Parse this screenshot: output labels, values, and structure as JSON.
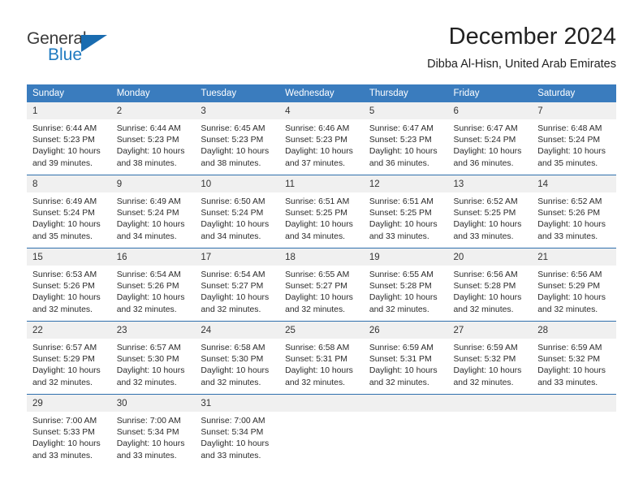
{
  "brand": {
    "name_part1": "General",
    "name_part2": "Blue",
    "flag_icon": "triangle-flag-icon",
    "accent_color": "#1a6cb0"
  },
  "header": {
    "month_title": "December 2024",
    "location": "Dibba Al-Hisn, United Arab Emirates"
  },
  "theme": {
    "header_row_bg": "#3a7cbe",
    "daynum_bg": "#f0f0f0",
    "row_separator": "#2f6fad",
    "text": "#2b2b2b"
  },
  "weekday_headers": [
    "Sunday",
    "Monday",
    "Tuesday",
    "Wednesday",
    "Thursday",
    "Friday",
    "Saturday"
  ],
  "labels": {
    "sunrise_prefix": "Sunrise:",
    "sunset_prefix": "Sunset:",
    "daylight_prefix": "Daylight:"
  },
  "weeks": [
    [
      {
        "day": "1",
        "sunrise": "Sunrise: 6:44 AM",
        "sunset": "Sunset: 5:23 PM",
        "daylight_l1": "Daylight: 10 hours",
        "daylight_l2": "and 39 minutes."
      },
      {
        "day": "2",
        "sunrise": "Sunrise: 6:44 AM",
        "sunset": "Sunset: 5:23 PM",
        "daylight_l1": "Daylight: 10 hours",
        "daylight_l2": "and 38 minutes."
      },
      {
        "day": "3",
        "sunrise": "Sunrise: 6:45 AM",
        "sunset": "Sunset: 5:23 PM",
        "daylight_l1": "Daylight: 10 hours",
        "daylight_l2": "and 38 minutes."
      },
      {
        "day": "4",
        "sunrise": "Sunrise: 6:46 AM",
        "sunset": "Sunset: 5:23 PM",
        "daylight_l1": "Daylight: 10 hours",
        "daylight_l2": "and 37 minutes."
      },
      {
        "day": "5",
        "sunrise": "Sunrise: 6:47 AM",
        "sunset": "Sunset: 5:23 PM",
        "daylight_l1": "Daylight: 10 hours",
        "daylight_l2": "and 36 minutes."
      },
      {
        "day": "6",
        "sunrise": "Sunrise: 6:47 AM",
        "sunset": "Sunset: 5:24 PM",
        "daylight_l1": "Daylight: 10 hours",
        "daylight_l2": "and 36 minutes."
      },
      {
        "day": "7",
        "sunrise": "Sunrise: 6:48 AM",
        "sunset": "Sunset: 5:24 PM",
        "daylight_l1": "Daylight: 10 hours",
        "daylight_l2": "and 35 minutes."
      }
    ],
    [
      {
        "day": "8",
        "sunrise": "Sunrise: 6:49 AM",
        "sunset": "Sunset: 5:24 PM",
        "daylight_l1": "Daylight: 10 hours",
        "daylight_l2": "and 35 minutes."
      },
      {
        "day": "9",
        "sunrise": "Sunrise: 6:49 AM",
        "sunset": "Sunset: 5:24 PM",
        "daylight_l1": "Daylight: 10 hours",
        "daylight_l2": "and 34 minutes."
      },
      {
        "day": "10",
        "sunrise": "Sunrise: 6:50 AM",
        "sunset": "Sunset: 5:24 PM",
        "daylight_l1": "Daylight: 10 hours",
        "daylight_l2": "and 34 minutes."
      },
      {
        "day": "11",
        "sunrise": "Sunrise: 6:51 AM",
        "sunset": "Sunset: 5:25 PM",
        "daylight_l1": "Daylight: 10 hours",
        "daylight_l2": "and 34 minutes."
      },
      {
        "day": "12",
        "sunrise": "Sunrise: 6:51 AM",
        "sunset": "Sunset: 5:25 PM",
        "daylight_l1": "Daylight: 10 hours",
        "daylight_l2": "and 33 minutes."
      },
      {
        "day": "13",
        "sunrise": "Sunrise: 6:52 AM",
        "sunset": "Sunset: 5:25 PM",
        "daylight_l1": "Daylight: 10 hours",
        "daylight_l2": "and 33 minutes."
      },
      {
        "day": "14",
        "sunrise": "Sunrise: 6:52 AM",
        "sunset": "Sunset: 5:26 PM",
        "daylight_l1": "Daylight: 10 hours",
        "daylight_l2": "and 33 minutes."
      }
    ],
    [
      {
        "day": "15",
        "sunrise": "Sunrise: 6:53 AM",
        "sunset": "Sunset: 5:26 PM",
        "daylight_l1": "Daylight: 10 hours",
        "daylight_l2": "and 32 minutes."
      },
      {
        "day": "16",
        "sunrise": "Sunrise: 6:54 AM",
        "sunset": "Sunset: 5:26 PM",
        "daylight_l1": "Daylight: 10 hours",
        "daylight_l2": "and 32 minutes."
      },
      {
        "day": "17",
        "sunrise": "Sunrise: 6:54 AM",
        "sunset": "Sunset: 5:27 PM",
        "daylight_l1": "Daylight: 10 hours",
        "daylight_l2": "and 32 minutes."
      },
      {
        "day": "18",
        "sunrise": "Sunrise: 6:55 AM",
        "sunset": "Sunset: 5:27 PM",
        "daylight_l1": "Daylight: 10 hours",
        "daylight_l2": "and 32 minutes."
      },
      {
        "day": "19",
        "sunrise": "Sunrise: 6:55 AM",
        "sunset": "Sunset: 5:28 PM",
        "daylight_l1": "Daylight: 10 hours",
        "daylight_l2": "and 32 minutes."
      },
      {
        "day": "20",
        "sunrise": "Sunrise: 6:56 AM",
        "sunset": "Sunset: 5:28 PM",
        "daylight_l1": "Daylight: 10 hours",
        "daylight_l2": "and 32 minutes."
      },
      {
        "day": "21",
        "sunrise": "Sunrise: 6:56 AM",
        "sunset": "Sunset: 5:29 PM",
        "daylight_l1": "Daylight: 10 hours",
        "daylight_l2": "and 32 minutes."
      }
    ],
    [
      {
        "day": "22",
        "sunrise": "Sunrise: 6:57 AM",
        "sunset": "Sunset: 5:29 PM",
        "daylight_l1": "Daylight: 10 hours",
        "daylight_l2": "and 32 minutes."
      },
      {
        "day": "23",
        "sunrise": "Sunrise: 6:57 AM",
        "sunset": "Sunset: 5:30 PM",
        "daylight_l1": "Daylight: 10 hours",
        "daylight_l2": "and 32 minutes."
      },
      {
        "day": "24",
        "sunrise": "Sunrise: 6:58 AM",
        "sunset": "Sunset: 5:30 PM",
        "daylight_l1": "Daylight: 10 hours",
        "daylight_l2": "and 32 minutes."
      },
      {
        "day": "25",
        "sunrise": "Sunrise: 6:58 AM",
        "sunset": "Sunset: 5:31 PM",
        "daylight_l1": "Daylight: 10 hours",
        "daylight_l2": "and 32 minutes."
      },
      {
        "day": "26",
        "sunrise": "Sunrise: 6:59 AM",
        "sunset": "Sunset: 5:31 PM",
        "daylight_l1": "Daylight: 10 hours",
        "daylight_l2": "and 32 minutes."
      },
      {
        "day": "27",
        "sunrise": "Sunrise: 6:59 AM",
        "sunset": "Sunset: 5:32 PM",
        "daylight_l1": "Daylight: 10 hours",
        "daylight_l2": "and 32 minutes."
      },
      {
        "day": "28",
        "sunrise": "Sunrise: 6:59 AM",
        "sunset": "Sunset: 5:32 PM",
        "daylight_l1": "Daylight: 10 hours",
        "daylight_l2": "and 33 minutes."
      }
    ],
    [
      {
        "day": "29",
        "sunrise": "Sunrise: 7:00 AM",
        "sunset": "Sunset: 5:33 PM",
        "daylight_l1": "Daylight: 10 hours",
        "daylight_l2": "and 33 minutes."
      },
      {
        "day": "30",
        "sunrise": "Sunrise: 7:00 AM",
        "sunset": "Sunset: 5:34 PM",
        "daylight_l1": "Daylight: 10 hours",
        "daylight_l2": "and 33 minutes."
      },
      {
        "day": "31",
        "sunrise": "Sunrise: 7:00 AM",
        "sunset": "Sunset: 5:34 PM",
        "daylight_l1": "Daylight: 10 hours",
        "daylight_l2": "and 33 minutes."
      },
      {
        "day": "",
        "sunrise": "",
        "sunset": "",
        "daylight_l1": "",
        "daylight_l2": ""
      },
      {
        "day": "",
        "sunrise": "",
        "sunset": "",
        "daylight_l1": "",
        "daylight_l2": ""
      },
      {
        "day": "",
        "sunrise": "",
        "sunset": "",
        "daylight_l1": "",
        "daylight_l2": ""
      },
      {
        "day": "",
        "sunrise": "",
        "sunset": "",
        "daylight_l1": "",
        "daylight_l2": ""
      }
    ]
  ]
}
